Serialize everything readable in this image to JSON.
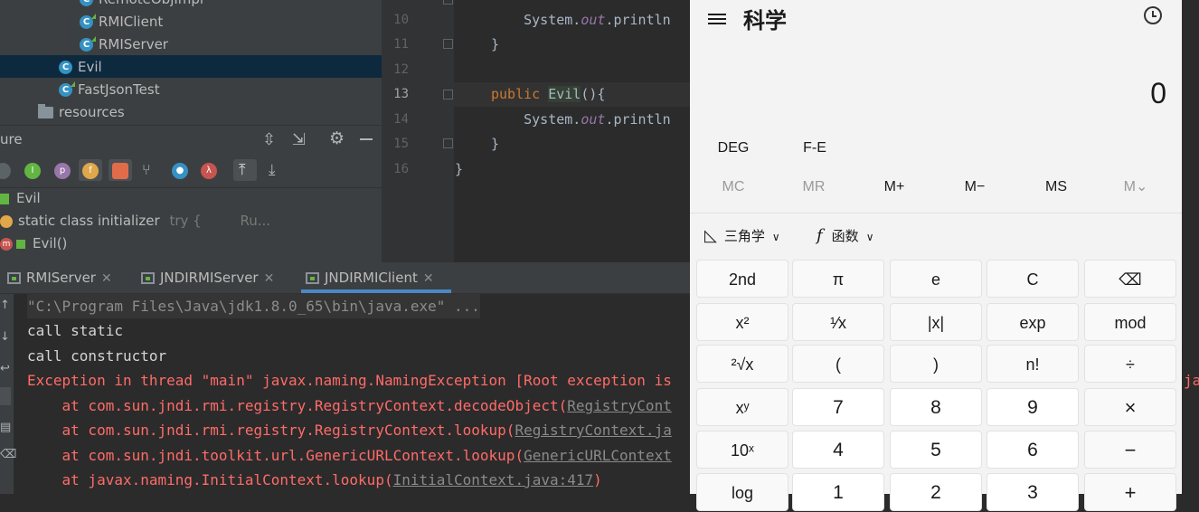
{
  "project_tree": {
    "items": [
      "RemoteObjImpl",
      "RMIClient",
      "RMIServer",
      "Evil",
      "FastJsonTest",
      "resources"
    ]
  },
  "structure": {
    "title": "ure",
    "items": [
      "Evil",
      "static class initializer",
      "try {",
      "Ru...",
      "Evil()"
    ]
  },
  "editor": {
    "line_numbers": [
      "10",
      "11",
      "12",
      "13",
      "14",
      "15",
      "16"
    ],
    "lines": {
      "l10_a": "    System.",
      "l10_b": "out",
      "l10_c": ".println",
      "l11": "}",
      "l13_kw": "public",
      "l13_name": "Evil",
      "l13_rest": "(){",
      "l14_a": "    System.",
      "l14_b": "out",
      "l14_c": ".println",
      "l15": "}",
      "l16": "}"
    }
  },
  "run_tabs": [
    "RMIServer",
    "JNDIRMIServer",
    "JNDIRMIClient"
  ],
  "console": {
    "cmd": "\"C:\\Program Files\\Java\\jdk1.8.0_65\\bin\\java.exe\" ...",
    "out1": "call static",
    "out2": "call constructor",
    "exc": "Exception in thread \"main\" javax.naming.NamingException [Root exception is",
    "st1_a": "    at com.sun.jndi.rmi.registry.RegistryContext.decodeObject(",
    "st1_b": "RegistryCont",
    "st2_a": "    at com.sun.jndi.rmi.registry.RegistryContext.lookup(",
    "st2_b": "RegistryContext.ja",
    "st3_a": "    at com.sun.jndi.toolkit.url.GenericURLContext.lookup(",
    "st3_b": "GenericURLContext",
    "st4_a": "    at javax.naming.InitialContext.lookup(",
    "st4_b": "InitialContext.java:417",
    "st4_c": ")",
    "overflow": "ja"
  },
  "calculator": {
    "title": "科学",
    "display": "0",
    "mode_buttons": [
      "DEG",
      "F-E"
    ],
    "memory": [
      "MC",
      "MR",
      "M+",
      "M−",
      "MS",
      "M⌄"
    ],
    "trig_label": "三角学",
    "func_label": "函数",
    "keys": {
      "r1": [
        "2nd",
        "π",
        "e",
        "C",
        "⌫"
      ],
      "r2": [
        "x²",
        "¹⁄x",
        "|x|",
        "exp",
        "mod"
      ],
      "r3": [
        "²√x",
        "(",
        ")",
        "n!",
        "÷"
      ],
      "r4": [
        "xʸ",
        "7",
        "8",
        "9",
        "×"
      ],
      "r5": [
        "10ˣ",
        "4",
        "5",
        "6",
        "−"
      ],
      "r6": [
        "log",
        "1",
        "2",
        "3",
        "+"
      ]
    }
  },
  "colors": {
    "ide_bg": "#2b2b2b",
    "panel_bg": "#3c3f41",
    "selection": "#0d293e",
    "error_red": "#ff6b68",
    "keyword": "#cc7832",
    "calc_bg": "#f3f3f3"
  }
}
